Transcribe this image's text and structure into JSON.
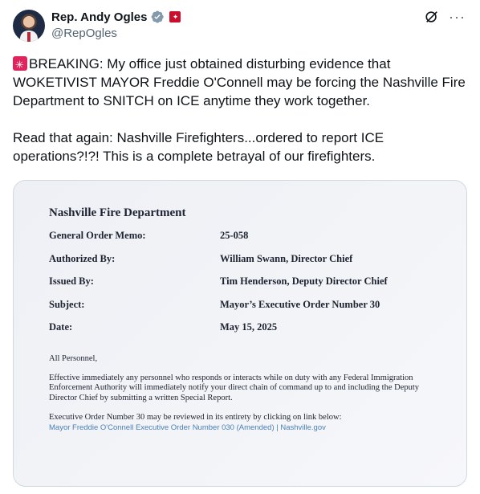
{
  "header": {
    "name": "Rep. Andy Ogles",
    "handle": "@RepOgles",
    "verified_icon": "verified-badge-icon",
    "flag_icon": "tennessee-flag-icon",
    "grok_icon": "grok-icon",
    "more_icon": "more-icon",
    "more_glyph": "···",
    "accent_color": "#1d9bf0"
  },
  "tweet": {
    "siren_icon": "siren-emoji-icon",
    "text": "BREAKING: My office just obtained disturbing evidence that WOKETIVIST MAYOR Freddie O'Connell may be forcing the Nashville Fire Department to SNITCH on ICE anytime they work together.\n\nRead that again: Nashville Firefighters...ordered to report ICE operations?!?! This is a complete betrayal of our firefighters."
  },
  "document": {
    "title": "Nashville Fire Department",
    "rows": [
      {
        "label": "General Order Memo:",
        "value": "25-058"
      },
      {
        "label": "Authorized By:",
        "value": "William Swann, Director Chief"
      },
      {
        "label": "Issued By:",
        "value": "Tim Henderson, Deputy Director Chief"
      },
      {
        "label": "Subject:",
        "value": "Mayor’s Executive Order Number 30"
      },
      {
        "label": "Date:",
        "value": "May 15, 2025"
      }
    ],
    "salutation": "All Personnel,",
    "body": "Effective immediately any personnel who responds or interacts while on duty with any Federal Immigration Enforcement Authority will immediately notify your direct chain of command up to and including the Deputy Director Chief by submitting a written Special Report.",
    "review_text": "Executive Order Number 30 may be reviewed in its entirety by clicking on link below:",
    "link_text": "Mayor Freddie O'Connell Executive Order Number 030 (Amended) | Nashville.gov"
  }
}
